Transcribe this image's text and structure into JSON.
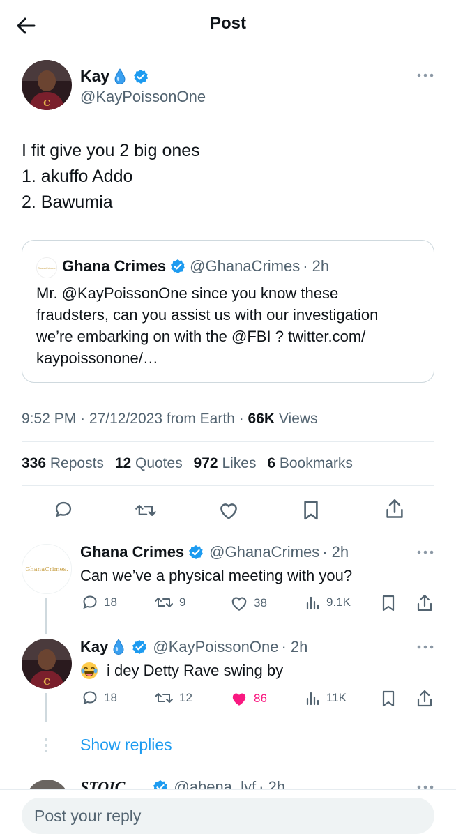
{
  "header": {
    "title": "Post"
  },
  "post": {
    "author": {
      "name": "Kay",
      "handle": "@KayPoissonOne"
    },
    "text_lines": [
      "I fit give you 2 big ones",
      "1. akuffo Addo",
      "2. Bawumia"
    ],
    "quote": {
      "author_name": "Ghana Crimes",
      "handle": "@GhanaCrimes",
      "time": "· 2h",
      "text_lines": [
        "Mr. @KayPoissonOne since you know these",
        "fraudsters, can you assist us with our investigation",
        "we’re embarking on with the @FBI ? twitter.com/",
        "kaypoissonone/…"
      ]
    },
    "meta": {
      "time": "9:52 PM",
      "date": "27/12/2023",
      "source": "from Earth",
      "views_count": "66K",
      "views_label": "Views"
    },
    "stats": {
      "reposts_count": "336",
      "reposts_label": "Reposts",
      "quotes_count": "12",
      "quotes_label": "Quotes",
      "likes_count": "972",
      "likes_label": "Likes",
      "bookmarks_count": "6",
      "bookmarks_label": "Bookmarks"
    }
  },
  "replies": [
    {
      "author_name": "Ghana Crimes",
      "handle": "@GhanaCrimes",
      "time": "· 2h",
      "avatar_text": "GhanaCrimes.",
      "text": "Can we’ve a physical meeting with you?",
      "replies": "18",
      "reposts": "9",
      "likes": "38",
      "views": "9.1K",
      "liked": false
    },
    {
      "author_name": "Kay",
      "handle": "@KayPoissonOne",
      "time": "· 2h",
      "text": "i dey Detty Rave swing by",
      "replies": "18",
      "reposts": "12",
      "likes": "86",
      "views": "11K",
      "liked": true
    }
  ],
  "show_replies": "Show replies",
  "next_reply": {
    "author_name": "STOIC",
    "handle": "@abena_lyf",
    "time": "· 2h"
  },
  "composer": {
    "placeholder": "Post your reply"
  },
  "colors": {
    "accent": "#1d9bf0",
    "like": "#f91880",
    "text": "#0f1419",
    "secondary": "#536471"
  }
}
